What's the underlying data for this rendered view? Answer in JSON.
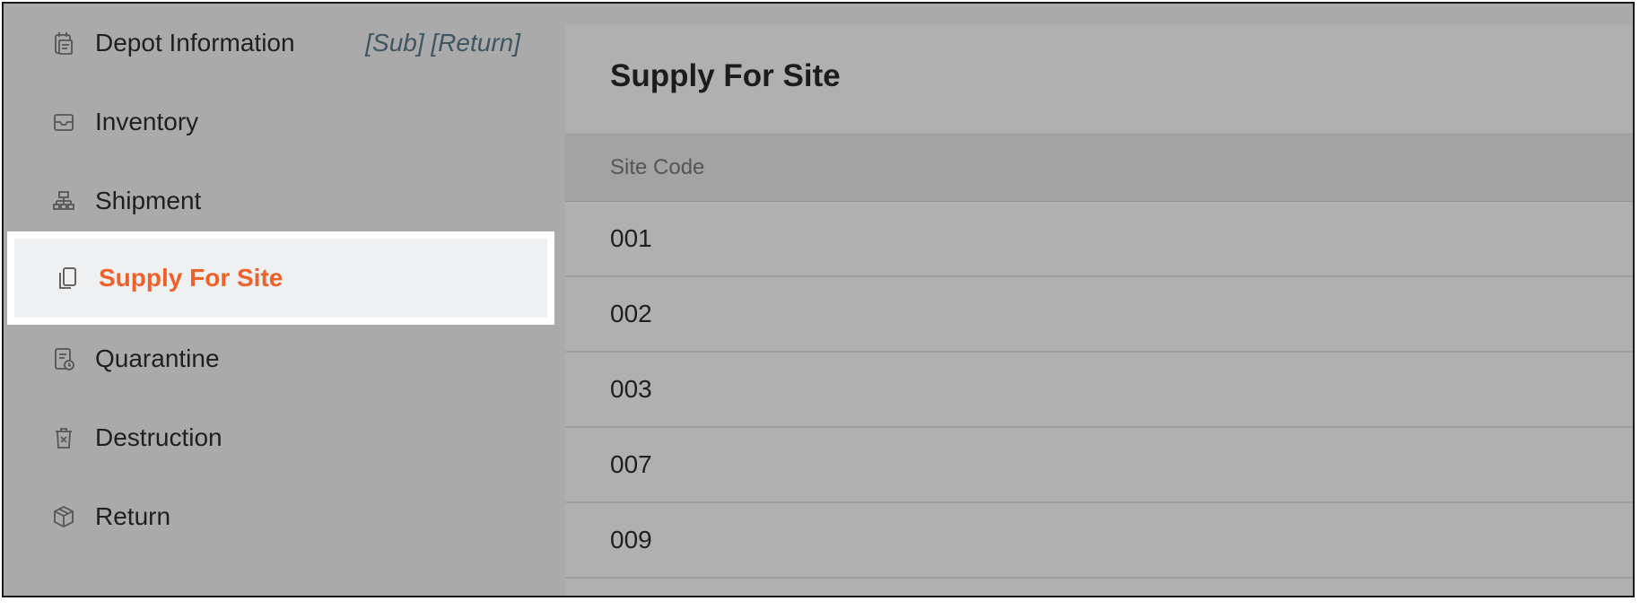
{
  "sidebar": {
    "items": [
      {
        "label": "Depot Information",
        "extra": "[Sub] [Return]",
        "icon": "calendar-clipboard-icon"
      },
      {
        "label": "Inventory",
        "icon": "inbox-icon"
      },
      {
        "label": "Shipment",
        "icon": "hierarchy-icon"
      },
      {
        "label": "Supply For Site",
        "icon": "copy-document-icon",
        "active": true
      },
      {
        "label": "Quarantine",
        "icon": "document-clock-icon"
      },
      {
        "label": "Destruction",
        "icon": "trash-x-icon"
      },
      {
        "label": "Return",
        "icon": "package-icon"
      }
    ]
  },
  "main": {
    "title": "Supply For Site",
    "table": {
      "columns": [
        "Site Code"
      ],
      "rows": [
        "001",
        "002",
        "003",
        "007",
        "009"
      ]
    }
  },
  "colors": {
    "active_text": "#f0612a",
    "extra_text": "#3e5662",
    "background": "#aaaaaa",
    "active_background": "#eff0f1"
  }
}
